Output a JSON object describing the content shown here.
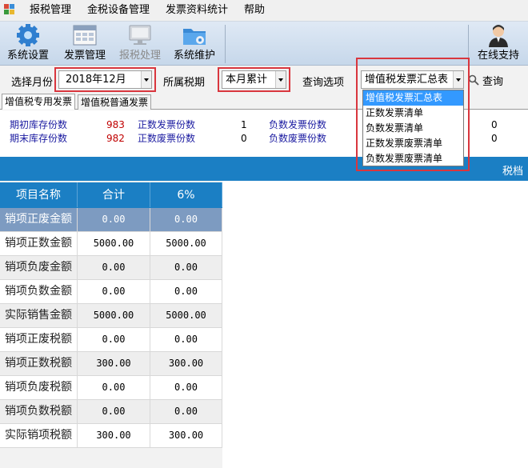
{
  "menubar": {
    "items": [
      "报税管理",
      "金税设备管理",
      "发票资料统计",
      "帮助"
    ]
  },
  "toolbar": {
    "buttons": [
      {
        "label": "系统设置",
        "icon": "gear-icon"
      },
      {
        "label": "发票管理",
        "icon": "invoice-icon"
      },
      {
        "label": "报税处理",
        "icon": "monitor-icon",
        "disabled": true
      },
      {
        "label": "系统维护",
        "icon": "folder-gear-icon"
      }
    ],
    "support": {
      "label": "在线支持",
      "icon": "support-person-icon"
    }
  },
  "filters": {
    "month_label": "选择月份",
    "month_value": "2018年12月",
    "period_label": "所属税期",
    "period_value": "本月累计",
    "query_option_label": "查询选项",
    "query_option_value": "增值税发票汇总表",
    "query_button": "查询"
  },
  "dropdown": {
    "options": [
      "增值税发票汇总表",
      "正数发票清单",
      "负数发票清单",
      "正数发票废票清单",
      "负数发票废票清单"
    ],
    "highlighted_index": 0
  },
  "tabs": [
    "增值税专用发票",
    "增值税普通发票"
  ],
  "stats": {
    "opening_stock_label": "期初库存份数",
    "opening_stock_value": "983",
    "closing_stock_label": "期末库存份数",
    "closing_stock_value": "982",
    "positive_invoice_label": "正数发票份数",
    "positive_invoice_value": "1",
    "positive_void_label": "正数废票份数",
    "positive_void_value": "0",
    "negative_invoice_label": "负数发票份数",
    "negative_invoice_value": "0",
    "negative_void_label": "负数废票份数",
    "negative_void_value": "0"
  },
  "band": {
    "text": "税档"
  },
  "table": {
    "headers": [
      "项目名称",
      "合计",
      "6%"
    ],
    "rows": [
      {
        "name": "销项正废金额",
        "total": "0.00",
        "rate6": "0.00"
      },
      {
        "name": "销项正数金额",
        "total": "5000.00",
        "rate6": "5000.00"
      },
      {
        "name": "销项负废金额",
        "total": "0.00",
        "rate6": "0.00"
      },
      {
        "name": "销项负数金额",
        "total": "0.00",
        "rate6": "0.00"
      },
      {
        "name": "实际销售金额",
        "total": "5000.00",
        "rate6": "5000.00"
      },
      {
        "name": "销项正废税额",
        "total": "0.00",
        "rate6": "0.00"
      },
      {
        "name": "销项正数税额",
        "total": "300.00",
        "rate6": "300.00"
      },
      {
        "name": "销项负废税额",
        "total": "0.00",
        "rate6": "0.00"
      },
      {
        "name": "销项负数税额",
        "total": "0.00",
        "rate6": "0.00"
      },
      {
        "name": "实际销项税额",
        "total": "300.00",
        "rate6": "300.00"
      }
    ],
    "selected_row": 0
  },
  "colors": {
    "accent_blue": "#1b7fc4",
    "highlight_red": "#d9363e",
    "selected_row": "#7d9bc1",
    "dropdown_highlight": "#3399ff"
  }
}
